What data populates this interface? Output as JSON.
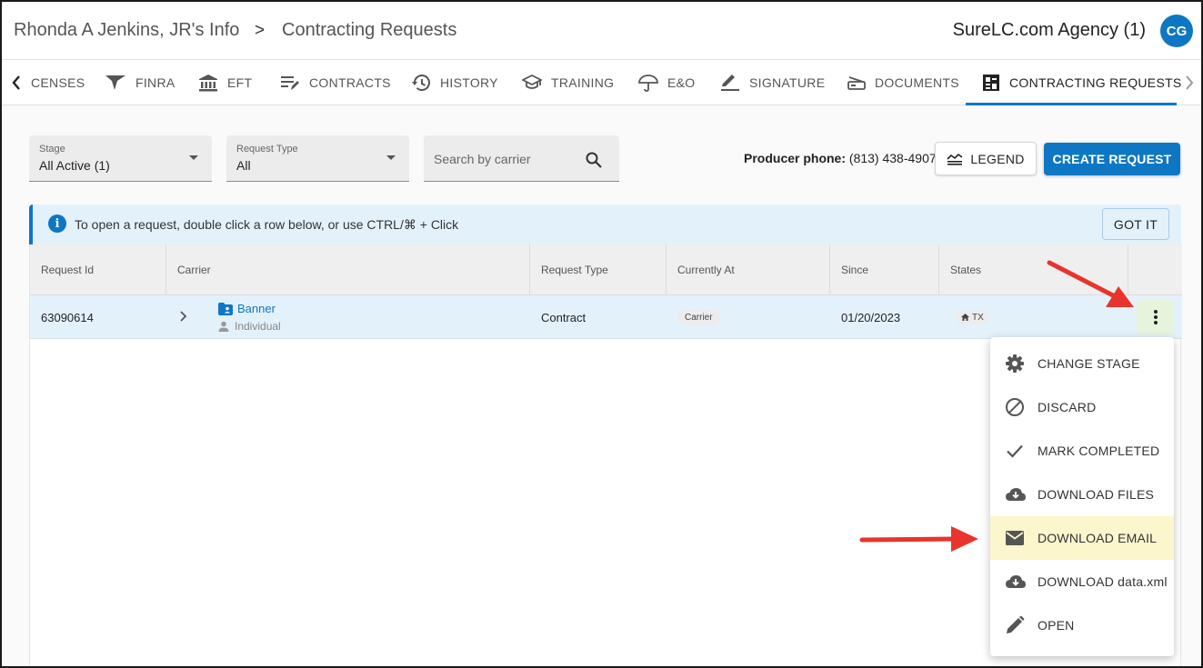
{
  "header": {
    "crumb_person": "Rhonda A Jenkins, JR's Info",
    "crumb_separator": ">",
    "crumb_page": "Contracting Requests",
    "agency": "SureLC.com Agency (1)",
    "avatar_initials": "CG"
  },
  "tabs": [
    {
      "label": "CENSES",
      "icon": "id-card-icon"
    },
    {
      "label": "FINRA",
      "icon": "finra-icon"
    },
    {
      "label": "EFT",
      "icon": "bank-icon"
    },
    {
      "label": "CONTRACTS",
      "icon": "edit-notes-icon"
    },
    {
      "label": "HISTORY",
      "icon": "history-icon"
    },
    {
      "label": "TRAINING",
      "icon": "school-icon"
    },
    {
      "label": "E&O",
      "icon": "umbrella-icon"
    },
    {
      "label": "SIGNATURE",
      "icon": "pen-icon"
    },
    {
      "label": "DOCUMENTS",
      "icon": "scanner-icon"
    },
    {
      "label": "CONTRACTING REQUESTS",
      "icon": "dashboard-icon"
    }
  ],
  "filters": {
    "stage_label": "Stage",
    "stage_value": "All Active (1)",
    "request_type_label": "Request Type",
    "request_type_value": "All",
    "search_placeholder": "Search by carrier"
  },
  "producer": {
    "label": "Producer phone:",
    "phone": "(813) 438-4907"
  },
  "buttons": {
    "legend": "LEGEND",
    "create_request": "CREATE REQUEST",
    "got_it": "GOT IT"
  },
  "banner": {
    "text": "To open a request, double click a row below, or use CTRL/⌘ + Click"
  },
  "table": {
    "columns": [
      "Request Id",
      "Carrier",
      "Request Type",
      "Currently At",
      "Since",
      "States"
    ],
    "rows": [
      {
        "request_id": "63090614",
        "carrier": "Banner",
        "carrier_sub": "Individual",
        "request_type": "Contract",
        "currently_at": "Carrier",
        "since": "01/20/2023",
        "state": "TX"
      }
    ]
  },
  "menu": {
    "items": [
      {
        "label": "CHANGE STAGE",
        "icon": "gear-icon"
      },
      {
        "label": "DISCARD",
        "icon": "block-icon"
      },
      {
        "label": "MARK COMPLETED",
        "icon": "check-icon"
      },
      {
        "label": "DOWNLOAD FILES",
        "icon": "cloud-download-icon"
      },
      {
        "label": "DOWNLOAD EMAIL",
        "icon": "mail-icon"
      },
      {
        "label": "DOWNLOAD data.xml",
        "icon": "cloud-download-icon"
      },
      {
        "label": "OPEN",
        "icon": "pencil-icon"
      }
    ]
  },
  "colors": {
    "primary": "#0d77c4",
    "highlight": "#fbf6cc",
    "arrow": "#e8342c"
  }
}
